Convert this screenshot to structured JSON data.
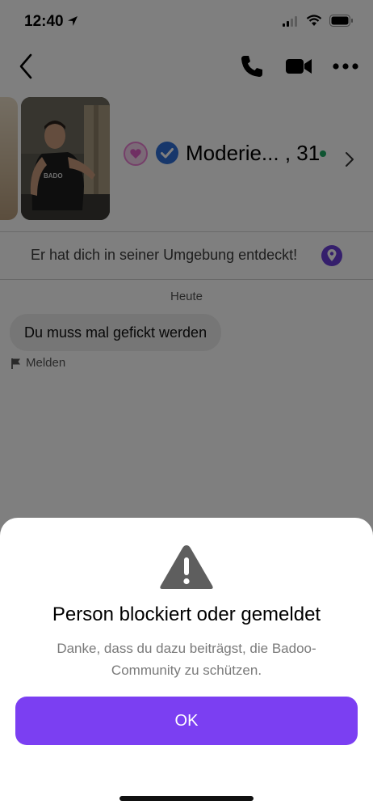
{
  "status_bar": {
    "time": "12:40"
  },
  "profile": {
    "name": "Moderie... , 31"
  },
  "discovery": {
    "text": "Er hat dich in seiner Umgebung entdeckt!"
  },
  "chat": {
    "day_label": "Heute",
    "messages": [
      {
        "text": "Du muss mal gefickt werden",
        "action": "Melden"
      }
    ]
  },
  "dialog": {
    "title": "Person blockiert oder gemeldet",
    "body": "Danke, dass du dazu beiträgst, die Badoo-Community zu schützen.",
    "ok_label": "OK"
  },
  "colors": {
    "accent": "#7b3ff2",
    "verified": "#2e6fd6",
    "online": "#1fa862",
    "pin": "#6b3fd9"
  },
  "icons": [
    "location-arrow-icon",
    "signal-icon",
    "wifi-icon",
    "battery-icon",
    "back-chevron-icon",
    "phone-icon",
    "video-icon",
    "more-icon",
    "heart-badge-icon",
    "verified-badge-icon",
    "chevron-right-icon",
    "location-pin-icon",
    "flag-icon",
    "warning-icon"
  ]
}
